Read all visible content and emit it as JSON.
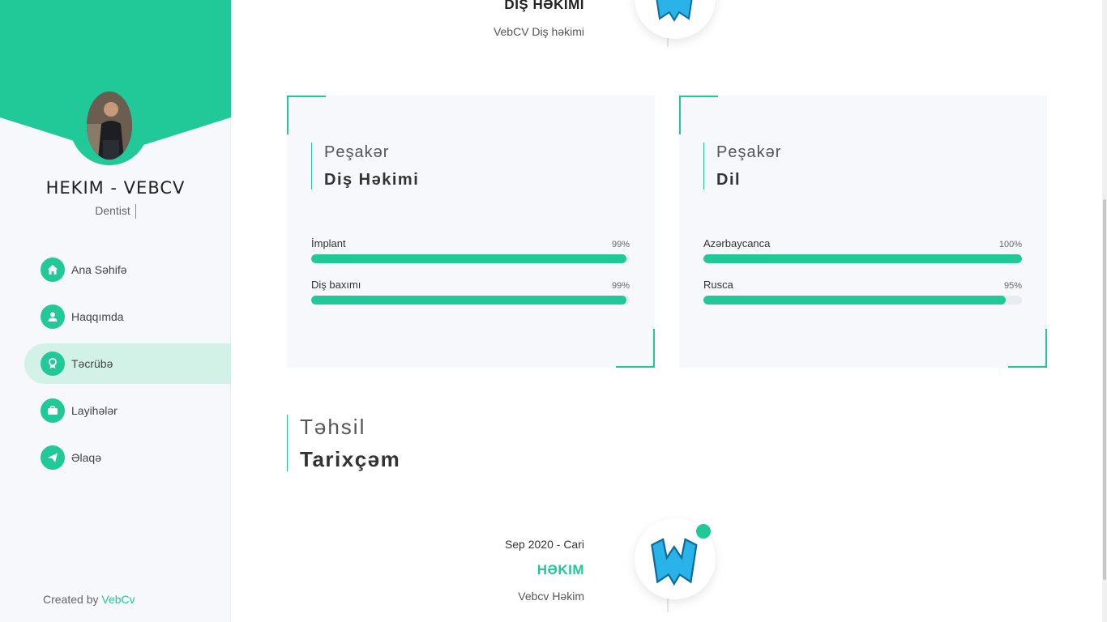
{
  "sidebar": {
    "brand_title": "HEKIM - VEBCV",
    "brand_subtitle": "Dentist",
    "accent_color": "#20c997",
    "nav": [
      {
        "label": "Ana Səhifə",
        "icon": "home-icon"
      },
      {
        "label": "Haqqımda",
        "icon": "user-icon"
      },
      {
        "label": "Təcrübə",
        "icon": "award-icon",
        "active": true
      },
      {
        "label": "Layihələr",
        "icon": "briefcase-icon"
      },
      {
        "label": "Əlaqə",
        "icon": "paper-plane-icon"
      }
    ],
    "footer_prefix": "Created by",
    "footer_link": "VebCv"
  },
  "experience_top": {
    "title": "DIŞ HƏKIMI",
    "company": "VebCV Diş həkimi"
  },
  "skill_cards": [
    {
      "kicker": "Peşakər",
      "title": "Diş Həkimi",
      "skills": [
        {
          "name": "İmplant",
          "percent_label": "99%",
          "percent": 99
        },
        {
          "name": "Diş baxımı",
          "percent_label": "99%",
          "percent": 99
        }
      ]
    },
    {
      "kicker": "Peşakər",
      "title": "Dil",
      "skills": [
        {
          "name": "Azərbaycanca",
          "percent_label": "100%",
          "percent": 100
        },
        {
          "name": "Rusca",
          "percent_label": "95%",
          "percent": 95
        }
      ]
    }
  ],
  "education": {
    "kicker": "Təhsil",
    "title": "Tarixçəm",
    "entry": {
      "date": "Sep 2020 - Cari",
      "title": "HƏKIM",
      "company": "Vebcv Həkim"
    }
  }
}
